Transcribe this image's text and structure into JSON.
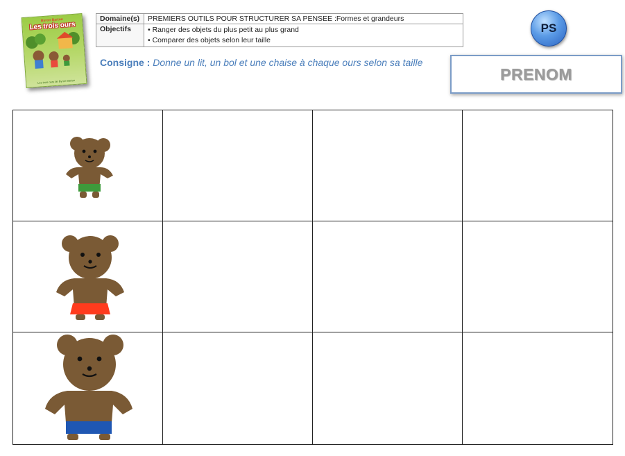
{
  "book": {
    "author": "Byron Barton",
    "title": "Les trois ours",
    "footer": "Les trois ours de Byron Barton"
  },
  "info_table": {
    "domaine_label": "Domaine(s)",
    "domaine_value": "PREMIERS OUTILS POUR STRUCTURER SA PENSEE :Formes et grandeurs",
    "objectifs_label": "Objectifs",
    "objectifs": [
      "• Ranger des objets du plus petit au plus grand",
      "• Comparer des objets selon leur taille"
    ]
  },
  "consigne": {
    "label": "Consigne :",
    "text": "Donne un lit, un bol et une chaise à chaque ours selon sa taille"
  },
  "level_badge": "PS",
  "name_box": "PRENOM",
  "grid": {
    "rows": [
      {
        "bear": "small-bear",
        "shorts_color": "#3d9a3b"
      },
      {
        "bear": "medium-bear",
        "shorts_color": "#ff3b1d"
      },
      {
        "bear": "big-bear",
        "shorts_color": "#1f57b3"
      }
    ]
  },
  "colors": {
    "bear_brown": "#7a5a35",
    "consigne_blue": "#4a7ebb",
    "badge_blue": "#3b78d8"
  }
}
